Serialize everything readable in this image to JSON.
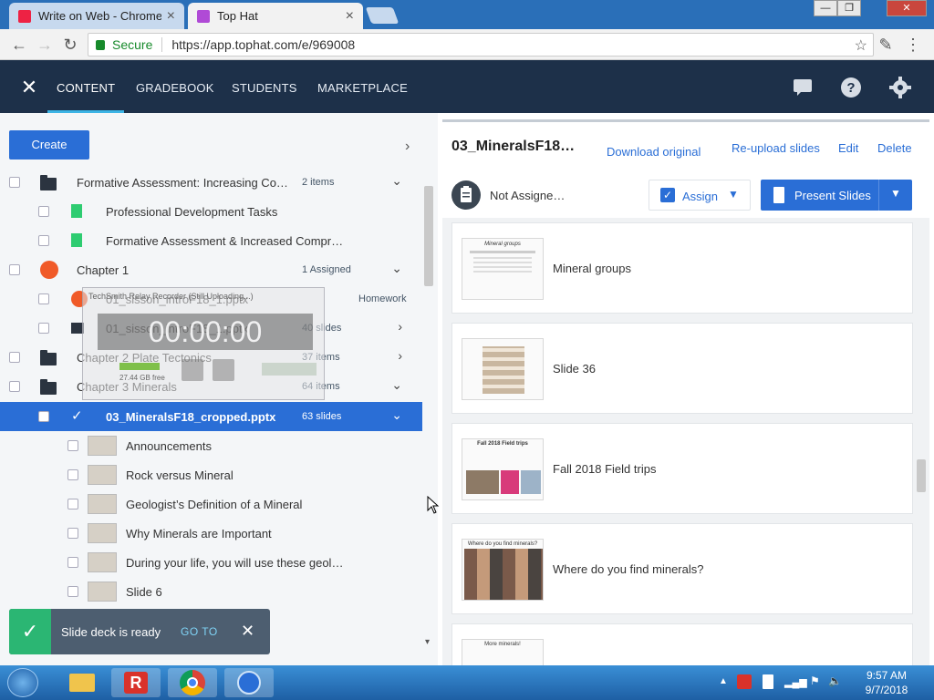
{
  "browser": {
    "tabs": [
      {
        "title": "Write on Web - Chrome",
        "close": "×"
      },
      {
        "title": "Top Hat",
        "close": "×"
      }
    ],
    "window_controls": [
      "—",
      "❐",
      "✕"
    ],
    "address": {
      "secure_label": "Secure",
      "url": "https://app.tophat.com/e/969008"
    }
  },
  "app_header": {
    "close_icon": "close-icon",
    "tabs": [
      {
        "label": "CONTENT",
        "active": true
      },
      {
        "label": "GRADEBOOK",
        "active": false
      },
      {
        "label": "STUDENTS",
        "active": false
      },
      {
        "label": "MARKETPLACE",
        "active": false
      }
    ],
    "icons": [
      "chat-icon",
      "help-icon",
      "gear-icon"
    ]
  },
  "left": {
    "create_label": "Create",
    "rows": [
      {
        "label": "Formative Assessment: Increasing Co…",
        "meta": "2 items",
        "icon": "folder",
        "indent": 0,
        "chev": "⌄"
      },
      {
        "label": "Professional Development Tasks",
        "meta": "",
        "icon": "doc",
        "indent": 1,
        "chev": ""
      },
      {
        "label": "Formative Assessment & Increased Compr…",
        "meta": "",
        "icon": "doc",
        "indent": 1,
        "chev": ""
      },
      {
        "label": "Chapter 1",
        "meta": "1 Assigned",
        "icon": "circle",
        "indent": 0,
        "chev": "⌄"
      },
      {
        "label": "01_sisson_introF18_1.pptx",
        "meta": "Homework",
        "icon": "attach",
        "indent": 1,
        "chev": ""
      },
      {
        "label": "01_sisson_introF18_1.pptx",
        "meta": "40 slides",
        "icon": "play",
        "indent": 1,
        "chev": "›"
      },
      {
        "label": "Chapter 2 Plate Tectonics",
        "meta": "37 items",
        "icon": "folder",
        "indent": 0,
        "chev": "›"
      },
      {
        "label": "Chapter 3 Minerals",
        "meta": "64 items",
        "icon": "folder",
        "indent": 0,
        "chev": "⌄"
      },
      {
        "label": "03_MineralsF18_cropped.pptx",
        "meta": "63 slides",
        "icon": "check",
        "indent": 1,
        "chev": "⌄",
        "selected": true
      },
      {
        "label": "Announcements",
        "meta": "",
        "icon": "thumb",
        "indent": 2,
        "chev": ""
      },
      {
        "label": "Rock versus Mineral",
        "meta": "",
        "icon": "thumb",
        "indent": 2,
        "chev": ""
      },
      {
        "label": "Geologist’s Definition of a Mineral",
        "meta": "",
        "icon": "thumb",
        "indent": 2,
        "chev": ""
      },
      {
        "label": "Why Minerals are Important",
        "meta": "",
        "icon": "thumb",
        "indent": 2,
        "chev": ""
      },
      {
        "label": "During your life, you will use these geol…",
        "meta": "",
        "icon": "thumb",
        "indent": 2,
        "chev": ""
      },
      {
        "label": "Slide 6",
        "meta": "",
        "icon": "thumb",
        "indent": 2,
        "chev": ""
      }
    ]
  },
  "recorder": {
    "title": "TechSmith Relay Recorder (Still Uploading...)",
    "timer": "00:00:00",
    "free_space": "27.44 GB free"
  },
  "toast": {
    "message": "Slide deck is ready",
    "action": "GO TO",
    "close": "✕"
  },
  "right": {
    "title": "03_MineralsF18…",
    "download": "Download original",
    "reupload": "Re-upload slides",
    "edit": "Edit",
    "delete": "Delete",
    "status": "Not Assigne…",
    "assign_label": "Assign",
    "present_label": "Present Slides",
    "slides": [
      {
        "title": "Mineral groups",
        "thumb_text": "Mineral groups"
      },
      {
        "title": "Slide 36",
        "thumb_text": ""
      },
      {
        "title": "Fall 2018 Field trips",
        "thumb_text": "Fall 2018 Field trips"
      },
      {
        "title": "Where do you find minerals?",
        "thumb_text": "Where do you find minerals?"
      },
      {
        "title": "",
        "thumb_text": "More minerals!"
      }
    ]
  },
  "taskbar": {
    "time": "9:57 AM",
    "date": "9/7/2018"
  },
  "colors": {
    "primary": "#2a6ed6",
    "header": "#1d3049",
    "success": "#2bb673"
  }
}
